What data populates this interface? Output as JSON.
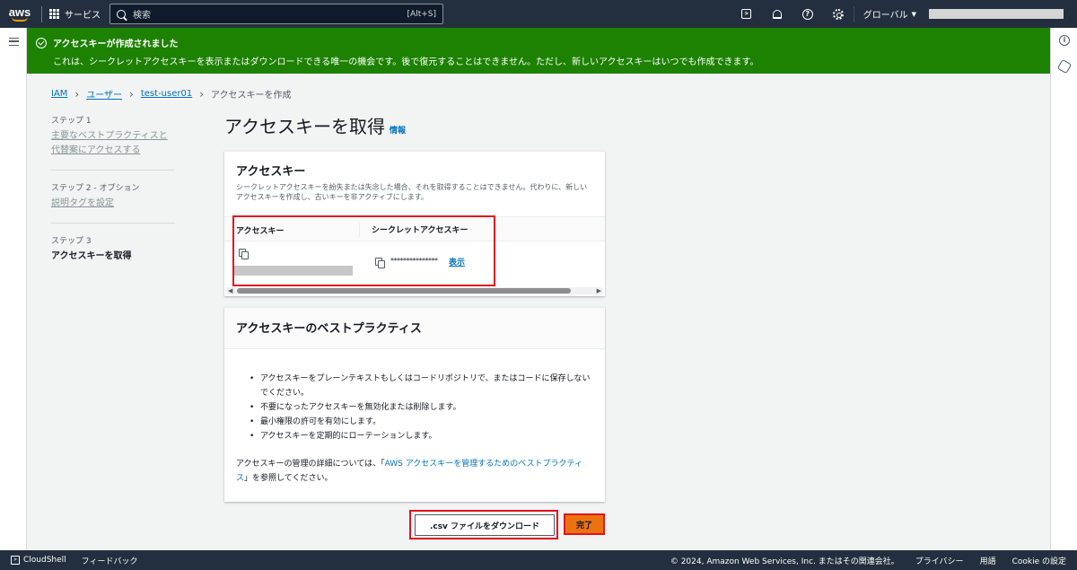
{
  "topnav": {
    "logo": "aws",
    "services_label": "サービス",
    "search_placeholder": "検索",
    "search_shortcut": "[Alt+S]",
    "region_label": "グローバル",
    "region_caret": "▼",
    "icons": [
      "cloudshell-icon",
      "bell-icon",
      "help-icon",
      "settings-icon"
    ]
  },
  "flash": {
    "title": "アクセスキーが作成されました",
    "message": "これは、シークレットアクセスキーを表示またはダウンロードできる唯一の機会です。後で復元することはできません。ただし、新しいアクセスキーはいつでも作成できます。",
    "color": "#1d8102"
  },
  "breadcrumb": {
    "items": [
      "IAM",
      "ユーザー",
      "test-user01"
    ],
    "current": "アクセスキーを作成",
    "separator": "›"
  },
  "steps": [
    {
      "label": "ステップ 1",
      "name": "主要なベストプラクティスと代替案にアクセスする"
    },
    {
      "label": "ステップ 2 - オプション",
      "name": "説明タグを設定"
    },
    {
      "label": "ステップ 3",
      "name": "アクセスキーを取得"
    }
  ],
  "page": {
    "title": "アクセスキーを取得",
    "info_link": "情報"
  },
  "access_key_card": {
    "title": "アクセスキー",
    "description": "シークレットアクセスキーを紛失または失念した場合、それを取得することはできません。代わりに、新しいアクセスキーを作成し、古いキーを非アクティブにします。",
    "columns": [
      "アクセスキー",
      "シークレットアクセスキー"
    ],
    "secret_masked": "***************",
    "show_label": "表示"
  },
  "best_practices_card": {
    "title": "アクセスキーのベストプラクティス",
    "items": [
      "アクセスキーをプレーンテキストもしくはコードリポジトリで、またはコードに保存しないでください。",
      "不要になったアクセスキーを無効化または削除します。",
      "最小権限の許可を有効にします。",
      "アクセスキーを定期的にローテーションします。"
    ],
    "footer_prefix": "アクセスキーの管理の詳細については、「",
    "footer_link": "AWS アクセスキーを管理するためのベストプラクティス",
    "footer_suffix": "」を参照してください。"
  },
  "buttons": {
    "download": ".csv ファイルをダウンロード",
    "done": "完了",
    "done_color": "#ec7211"
  },
  "footer": {
    "cloudshell": "CloudShell",
    "feedback": "フィードバック",
    "copyright": "© 2024, Amazon Web Services, Inc. またはその関連会社。",
    "privacy": "プライバシー",
    "terms": "用語",
    "cookie": "Cookie の設定"
  }
}
